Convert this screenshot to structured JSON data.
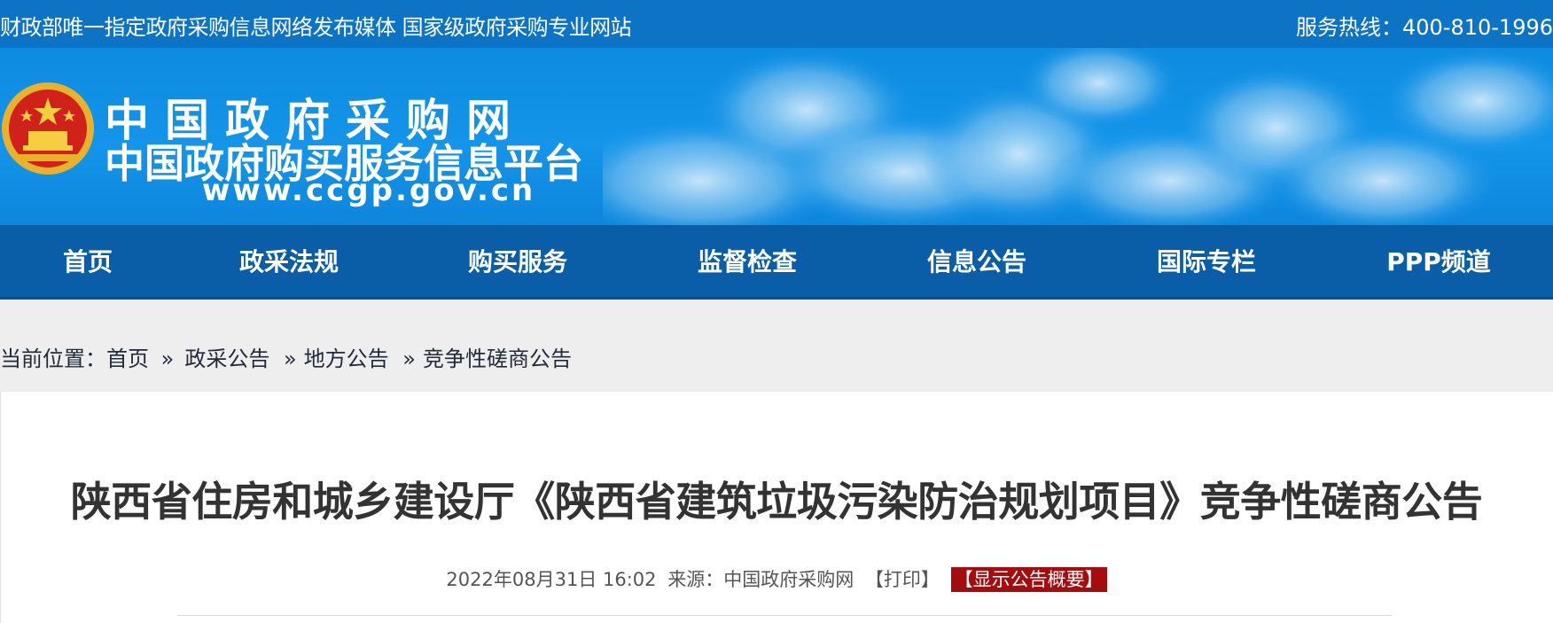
{
  "topbar": {
    "slogan": "财政部唯一指定政府采购信息网络发布媒体 国家级政府采购专业网站",
    "hotline": "服务热线：400-810-1996"
  },
  "header": {
    "emblem_icon": "national-emblem-icon",
    "title_cn": "中国政府采购网",
    "subtitle_cn": "中国政府购买服务信息平台",
    "url": "www.ccgp.gov.cn"
  },
  "nav": {
    "items": [
      {
        "label": "首页"
      },
      {
        "label": "政采法规"
      },
      {
        "label": "购买服务"
      },
      {
        "label": "监督检查"
      },
      {
        "label": "信息公告"
      },
      {
        "label": "国际专栏"
      },
      {
        "label": "PPP频道"
      }
    ]
  },
  "breadcrumb": {
    "prefix": "当前位置：",
    "items": [
      "首页",
      "政采公告",
      "地方公告",
      "竞争性磋商公告"
    ],
    "separator": "»"
  },
  "article": {
    "title": "陕西省住房和城乡建设厅《陕西省建筑垃圾污染防治规划项目》竞争性磋商公告",
    "datetime": "2022年08月31日 16:02",
    "source_label": "来源：",
    "source": "中国政府采购网",
    "print_label": "【打印】",
    "summary_label": "【显示公告概要】"
  },
  "colors": {
    "topbar": "#0d74c5",
    "banner": "#1495ea",
    "nav": "#0a5ea8",
    "summary_badge": "#a40d0d"
  }
}
